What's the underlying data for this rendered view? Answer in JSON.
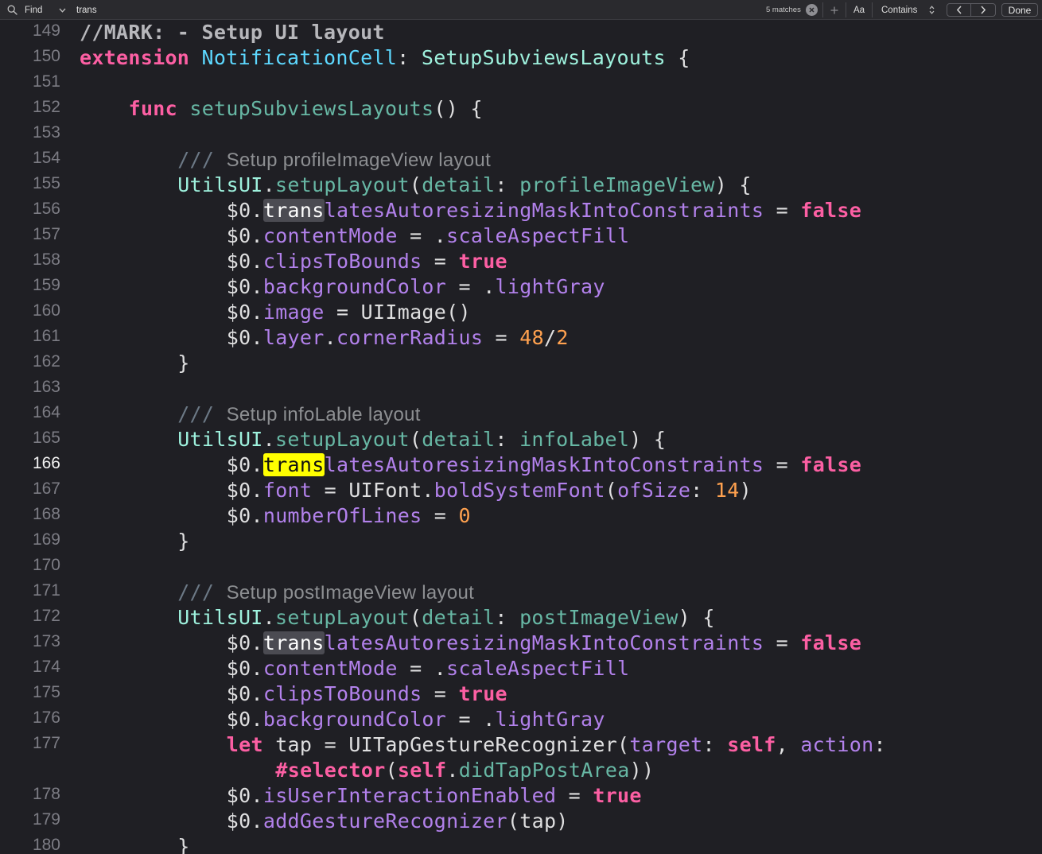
{
  "find_bar": {
    "mode_label": "Find",
    "query": "trans",
    "match_count": "5 matches",
    "case_label": "Aa",
    "contains_label": "Contains",
    "done_label": "Done",
    "icons": [
      "search-icon",
      "chevron-down-icon",
      "clear-icon",
      "plus-icon",
      "updown-chevron-icon",
      "previous-match-icon",
      "next-match-icon"
    ]
  },
  "colors": {
    "background": "#1f1f24",
    "keyword": "#fc5fa3",
    "type": "#5dd8ff",
    "function": "#67b7a4",
    "property": "#b281eb",
    "number": "#ffa14f",
    "match_highlight": "#ffff00"
  },
  "editor": {
    "current_line": 166,
    "lines": [
      {
        "n": "149",
        "indent": 0,
        "tokens": [
          [
            "mark",
            "//MARK: - Setup UI layout"
          ]
        ]
      },
      {
        "n": "150",
        "indent": 0,
        "tokens": [
          [
            "kw",
            "extension"
          ],
          [
            "plain",
            " "
          ],
          [
            "type",
            "NotificationCell"
          ],
          [
            "plain",
            ": "
          ],
          [
            "proto",
            "SetupSubviewsLayouts"
          ],
          [
            "plain",
            " {"
          ]
        ]
      },
      {
        "n": "151",
        "indent": 0,
        "tokens": []
      },
      {
        "n": "152",
        "indent": 1,
        "tokens": [
          [
            "kw",
            "func"
          ],
          [
            "plain",
            " "
          ],
          [
            "fn",
            "setupSubviewsLayouts"
          ],
          [
            "plain",
            "() {"
          ]
        ]
      },
      {
        "n": "153",
        "indent": 0,
        "tokens": []
      },
      {
        "n": "154",
        "indent": 2,
        "tokens": [
          [
            "comment",
            "/// "
          ],
          [
            "doc",
            "Setup profileImageView layout"
          ]
        ]
      },
      {
        "n": "155",
        "indent": 2,
        "tokens": [
          [
            "utils",
            "UtilsUI"
          ],
          [
            "plain",
            "."
          ],
          [
            "fn",
            "setupLayout"
          ],
          [
            "plain",
            "("
          ],
          [
            "fn",
            "detail"
          ],
          [
            "plain",
            ": "
          ],
          [
            "fn",
            "profileImageView"
          ],
          [
            "plain",
            ") {"
          ]
        ]
      },
      {
        "n": "156",
        "indent": 3,
        "tokens": [
          [
            "plain",
            "$0."
          ],
          [
            "match",
            "trans"
          ],
          [
            "prop",
            "latesAutoresizingMaskIntoConstraints"
          ],
          [
            "plain",
            " = "
          ],
          [
            "kw",
            "false"
          ]
        ]
      },
      {
        "n": "157",
        "indent": 3,
        "tokens": [
          [
            "plain",
            "$0."
          ],
          [
            "prop",
            "contentMode"
          ],
          [
            "plain",
            " = ."
          ],
          [
            "prop",
            "scaleAspectFill"
          ]
        ]
      },
      {
        "n": "158",
        "indent": 3,
        "tokens": [
          [
            "plain",
            "$0."
          ],
          [
            "prop",
            "clipsToBounds"
          ],
          [
            "plain",
            " = "
          ],
          [
            "kw",
            "true"
          ]
        ]
      },
      {
        "n": "159",
        "indent": 3,
        "tokens": [
          [
            "plain",
            "$0."
          ],
          [
            "prop",
            "backgroundColor"
          ],
          [
            "plain",
            " = ."
          ],
          [
            "prop",
            "lightGray"
          ]
        ]
      },
      {
        "n": "160",
        "indent": 3,
        "tokens": [
          [
            "plain",
            "$0."
          ],
          [
            "prop",
            "image"
          ],
          [
            "plain",
            " = UIImage()"
          ]
        ]
      },
      {
        "n": "161",
        "indent": 3,
        "tokens": [
          [
            "plain",
            "$0."
          ],
          [
            "prop",
            "layer"
          ],
          [
            "plain",
            "."
          ],
          [
            "prop",
            "cornerRadius"
          ],
          [
            "plain",
            " = "
          ],
          [
            "num",
            "48"
          ],
          [
            "plain",
            "/"
          ],
          [
            "num",
            "2"
          ]
        ]
      },
      {
        "n": "162",
        "indent": 2,
        "tokens": [
          [
            "plain",
            "}"
          ]
        ]
      },
      {
        "n": "163",
        "indent": 0,
        "tokens": []
      },
      {
        "n": "164",
        "indent": 2,
        "tokens": [
          [
            "comment",
            "/// "
          ],
          [
            "doc",
            "Setup infoLable layout"
          ]
        ]
      },
      {
        "n": "165",
        "indent": 2,
        "tokens": [
          [
            "utils",
            "UtilsUI"
          ],
          [
            "plain",
            "."
          ],
          [
            "fn",
            "setupLayout"
          ],
          [
            "plain",
            "("
          ],
          [
            "fn",
            "detail"
          ],
          [
            "plain",
            ": "
          ],
          [
            "fn",
            "infoLabel"
          ],
          [
            "plain",
            ") {"
          ]
        ]
      },
      {
        "n": "166",
        "indent": 3,
        "tokens": [
          [
            "plain",
            "$0."
          ],
          [
            "match-current",
            "trans"
          ],
          [
            "prop",
            "latesAutoresizingMaskIntoConstraints"
          ],
          [
            "plain",
            " = "
          ],
          [
            "kw",
            "false"
          ]
        ]
      },
      {
        "n": "167",
        "indent": 3,
        "tokens": [
          [
            "plain",
            "$0."
          ],
          [
            "prop",
            "font"
          ],
          [
            "plain",
            " = UIFont."
          ],
          [
            "prop",
            "boldSystemFont"
          ],
          [
            "plain",
            "("
          ],
          [
            "prop",
            "ofSize"
          ],
          [
            "plain",
            ": "
          ],
          [
            "num",
            "14"
          ],
          [
            "plain",
            ")"
          ]
        ]
      },
      {
        "n": "168",
        "indent": 3,
        "tokens": [
          [
            "plain",
            "$0."
          ],
          [
            "prop",
            "numberOfLines"
          ],
          [
            "plain",
            " = "
          ],
          [
            "num",
            "0"
          ]
        ]
      },
      {
        "n": "169",
        "indent": 2,
        "tokens": [
          [
            "plain",
            "}"
          ]
        ]
      },
      {
        "n": "170",
        "indent": 0,
        "tokens": []
      },
      {
        "n": "171",
        "indent": 2,
        "tokens": [
          [
            "comment",
            "/// "
          ],
          [
            "doc",
            "Setup postImageView layout"
          ]
        ]
      },
      {
        "n": "172",
        "indent": 2,
        "tokens": [
          [
            "utils",
            "UtilsUI"
          ],
          [
            "plain",
            "."
          ],
          [
            "fn",
            "setupLayout"
          ],
          [
            "plain",
            "("
          ],
          [
            "fn",
            "detail"
          ],
          [
            "plain",
            ": "
          ],
          [
            "fn",
            "postImageView"
          ],
          [
            "plain",
            ") {"
          ]
        ]
      },
      {
        "n": "173",
        "indent": 3,
        "tokens": [
          [
            "plain",
            "$0."
          ],
          [
            "match",
            "trans"
          ],
          [
            "prop",
            "latesAutoresizingMaskIntoConstraints"
          ],
          [
            "plain",
            " = "
          ],
          [
            "kw",
            "false"
          ]
        ]
      },
      {
        "n": "174",
        "indent": 3,
        "tokens": [
          [
            "plain",
            "$0."
          ],
          [
            "prop",
            "contentMode"
          ],
          [
            "plain",
            " = ."
          ],
          [
            "prop",
            "scaleAspectFill"
          ]
        ]
      },
      {
        "n": "175",
        "indent": 3,
        "tokens": [
          [
            "plain",
            "$0."
          ],
          [
            "prop",
            "clipsToBounds"
          ],
          [
            "plain",
            " = "
          ],
          [
            "kw",
            "true"
          ]
        ]
      },
      {
        "n": "176",
        "indent": 3,
        "tokens": [
          [
            "plain",
            "$0."
          ],
          [
            "prop",
            "backgroundColor"
          ],
          [
            "plain",
            " = ."
          ],
          [
            "prop",
            "lightGray"
          ]
        ]
      },
      {
        "n": "177",
        "indent": 3,
        "tokens": [
          [
            "kw",
            "let"
          ],
          [
            "plain",
            " tap = UITapGestureRecognizer("
          ],
          [
            "prop",
            "target"
          ],
          [
            "plain",
            ": "
          ],
          [
            "kw",
            "self"
          ],
          [
            "plain",
            ", "
          ],
          [
            "prop",
            "action"
          ],
          [
            "plain",
            ":"
          ]
        ]
      },
      {
        "n": "",
        "indent": 4,
        "tokens": [
          [
            "kw",
            "#selector"
          ],
          [
            "plain",
            "("
          ],
          [
            "kw",
            "self"
          ],
          [
            "plain",
            "."
          ],
          [
            "fn",
            "didTapPostArea"
          ],
          [
            "plain",
            "))"
          ]
        ]
      },
      {
        "n": "178",
        "indent": 3,
        "tokens": [
          [
            "plain",
            "$0."
          ],
          [
            "prop",
            "isUserInteractionEnabled"
          ],
          [
            "plain",
            " = "
          ],
          [
            "kw",
            "true"
          ]
        ]
      },
      {
        "n": "179",
        "indent": 3,
        "tokens": [
          [
            "plain",
            "$0."
          ],
          [
            "prop",
            "addGestureRecognizer"
          ],
          [
            "plain",
            "(tap)"
          ]
        ]
      },
      {
        "n": "180",
        "indent": 2,
        "tokens": [
          [
            "plain",
            "}"
          ]
        ]
      }
    ]
  }
}
